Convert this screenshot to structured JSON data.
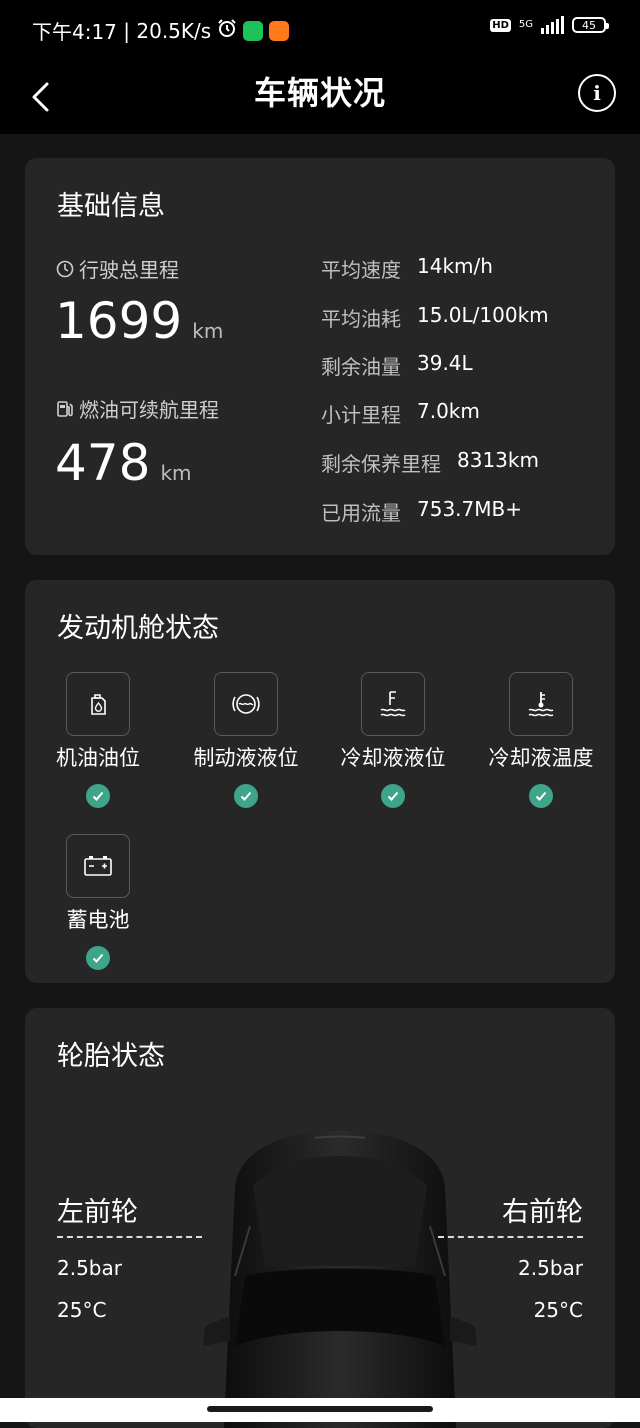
{
  "status_bar": {
    "time": "下午4:17",
    "speed": "20.5K/s",
    "hd": "HD",
    "network": "5G",
    "battery": "45"
  },
  "header": {
    "title": "车辆状况"
  },
  "basic": {
    "title": "基础信息",
    "total_mileage_label": "行驶总里程",
    "total_mileage_value": "1699",
    "total_mileage_unit": "km",
    "range_label": "燃油可续航里程",
    "range_value": "478",
    "range_unit": "km",
    "stats": [
      {
        "key": "平均速度",
        "value": "14km/h"
      },
      {
        "key": "平均油耗",
        "value": "15.0L/100km"
      },
      {
        "key": "剩余油量",
        "value": "39.4L"
      },
      {
        "key": "小计里程",
        "value": "7.0km"
      },
      {
        "key": "剩余保养里程",
        "value": "8313km"
      },
      {
        "key": "已用流量",
        "value": "753.7MB+"
      }
    ]
  },
  "engine": {
    "title": "发动机舱状态",
    "items": [
      {
        "label": "机油油位",
        "icon": "oil-level-icon",
        "status": "ok"
      },
      {
        "label": "制动液液位",
        "icon": "brake-fluid-icon",
        "status": "ok"
      },
      {
        "label": "冷却液液位",
        "icon": "coolant-level-icon",
        "status": "ok"
      },
      {
        "label": "冷却液温度",
        "icon": "coolant-temp-icon",
        "status": "ok"
      },
      {
        "label": "蓄电池",
        "icon": "battery-icon",
        "status": "ok"
      }
    ]
  },
  "tires": {
    "title": "轮胎状态",
    "front_left": {
      "label": "左前轮",
      "pressure": "2.5bar",
      "temp": "25°C"
    },
    "front_right": {
      "label": "右前轮",
      "pressure": "2.5bar",
      "temp": "25°C"
    }
  },
  "colors": {
    "background": "#151515",
    "card": "#262626",
    "check": "#3ea58a"
  }
}
